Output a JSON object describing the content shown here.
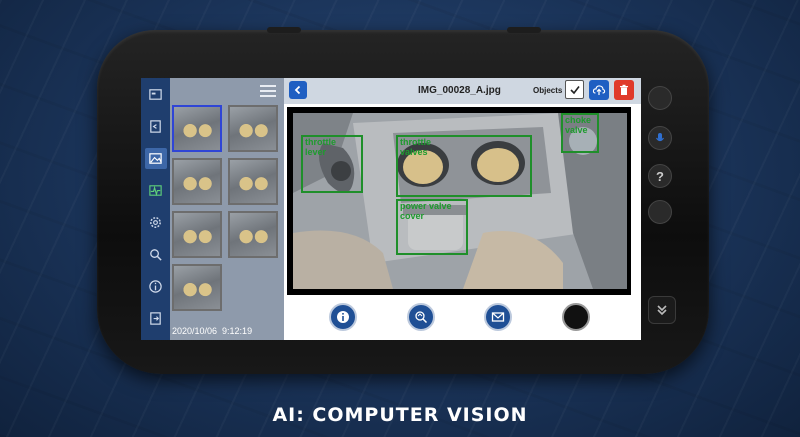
{
  "viewer": {
    "filename": "IMG_00028_A.jpg",
    "objects_label": "Objects",
    "objects_checked": true
  },
  "thumbnails": {
    "count": 7,
    "selected_index": 0,
    "timestamp": "2020/10/06  9:12:19"
  },
  "detections": [
    {
      "label": "throttle\nlever"
    },
    {
      "label": "throttle\nvalves"
    },
    {
      "label": "choke\nvalve"
    },
    {
      "label": "power valve\ncover"
    }
  ],
  "rail_icons": [
    "device-icon",
    "camera-icon",
    "gallery-icon",
    "waveform-icon",
    "settings-icon",
    "search-icon",
    "info-icon",
    "exit-icon"
  ],
  "bottom_buttons": [
    "info-icon",
    "assist-icon",
    "mail-icon",
    "record-icon"
  ],
  "caption": "AI: COMPUTER VISION",
  "colors": {
    "accent": "#1f5fc2",
    "delete": "#e03a2a",
    "detection": "#1f8f2a",
    "rail": "#1f3e6e"
  }
}
